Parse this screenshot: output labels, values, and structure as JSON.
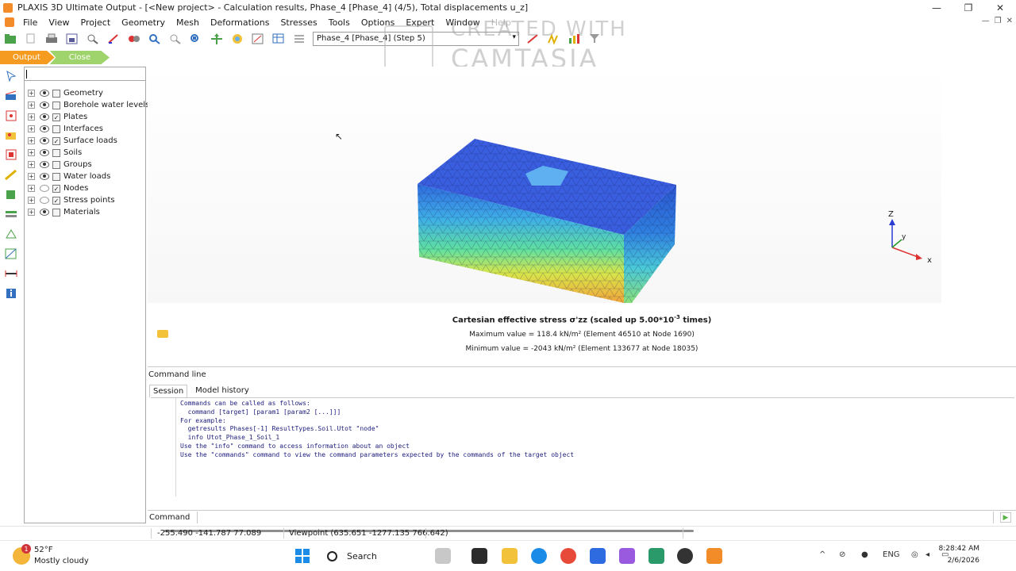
{
  "window": {
    "title": "PLAXIS 3D Ultimate Output - [<New project> - Calculation results, Phase_4 [Phase_4] (4/5), Total displacements u_z]",
    "controls": [
      "—",
      "❐",
      "✕"
    ]
  },
  "menu": {
    "items": [
      "File",
      "View",
      "Project",
      "Geometry",
      "Mesh",
      "Deformations",
      "Stresses",
      "Tools",
      "Options",
      "Expert",
      "Window",
      "Help"
    ]
  },
  "toolbar": {
    "phase_select": "Phase_4 [Phase_4] (Step 5)"
  },
  "watermark": {
    "line1": "CREATED WITH",
    "line2": "CAMTASIA"
  },
  "tabs": {
    "output_label": "Output",
    "close_label": "Close"
  },
  "tree": {
    "items": [
      {
        "label": "Geometry",
        "eye": "filled",
        "checked": false
      },
      {
        "label": "Borehole water levels",
        "eye": "filled",
        "checked": false
      },
      {
        "label": "Plates",
        "eye": "filled",
        "checked": true
      },
      {
        "label": "Interfaces",
        "eye": "filled",
        "checked": false
      },
      {
        "label": "Surface loads",
        "eye": "filled",
        "checked": true
      },
      {
        "label": "Soils",
        "eye": "filled",
        "checked": false
      },
      {
        "label": "Groups",
        "eye": "filled",
        "checked": false
      },
      {
        "label": "Water loads",
        "eye": "filled",
        "checked": false
      },
      {
        "label": "Nodes",
        "eye": "empty",
        "checked": true
      },
      {
        "label": "Stress points",
        "eye": "empty",
        "checked": true
      },
      {
        "label": "Materials",
        "eye": "filled",
        "checked": false
      }
    ]
  },
  "axes": {
    "z": "Z",
    "y": "y",
    "x": "x"
  },
  "legend": {
    "title": "Cartesian effective stress σ'zz (scaled up 5.00*10",
    "title_exp": "-3",
    "title_end": " times)",
    "max_line": "Maximum value = 118.4 kN/m² (Element 46510 at Node 1690)",
    "min_line": "Minimum value = -2043 kN/m² (Element 133677 at Node 18035)"
  },
  "command": {
    "section_title": "Command line",
    "tab_session": "Session",
    "tab_history": "Model history",
    "session_lines": "Commands can be called as follows:\n  command [target] [param1 [param2 [...]]]\nFor example:\n  getresults Phases[-1] ResultTypes.Soil.Utot \"node\"\n  info Utot_Phase_1_Soil_1\nUse the \"info\" command to access information about an object\nUse the \"commands\" command to view the command parameters expected by the commands of the target object",
    "input_label": "Command"
  },
  "status": {
    "coords": "-255.490 -141.787 77.089",
    "viewpoint": "Viewpoint (635.651 -1277.135 766.642)"
  },
  "taskbar": {
    "weather_badge": "1",
    "temperature": "52°F",
    "weather": "Mostly cloudy",
    "search": "Search",
    "lang": "ENG",
    "time": "8:28:42 AM",
    "date": "2/6/2026"
  }
}
